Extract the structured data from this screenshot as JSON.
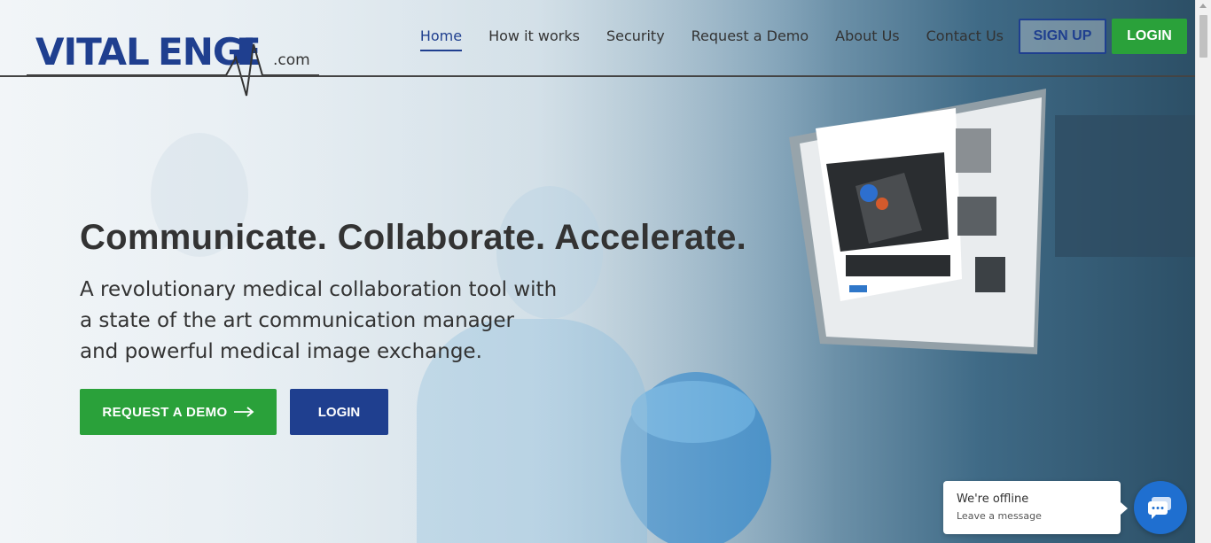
{
  "brand": {
    "logo_text": "VITALENGINE",
    "logo_suffix": ".com"
  },
  "nav": {
    "items": [
      {
        "label": "Home",
        "active": true
      },
      {
        "label": "How it works"
      },
      {
        "label": "Security"
      },
      {
        "label": "Request a Demo"
      },
      {
        "label": "About Us"
      },
      {
        "label": "Contact Us"
      }
    ],
    "signup_label": "SIGN UP",
    "login_label": "LOGIN"
  },
  "hero": {
    "title": "Communicate. Collaborate. Accelerate.",
    "subtitle": "A revolutionary medical collaboration tool with a state of the art communication manager and powerful medical image exchange.",
    "cta_demo": "REQUEST A DEMO",
    "cta_demo_icon": "arrow-right-icon",
    "cta_login": "LOGIN"
  },
  "chat": {
    "status": "We're offline",
    "prompt": "Leave a message",
    "icon": "chat-icon"
  },
  "colors": {
    "brand_blue": "#1f3f8f",
    "brand_green": "#2aa13a",
    "text_dark": "#333333",
    "chat_blue": "#1f6fd0"
  }
}
